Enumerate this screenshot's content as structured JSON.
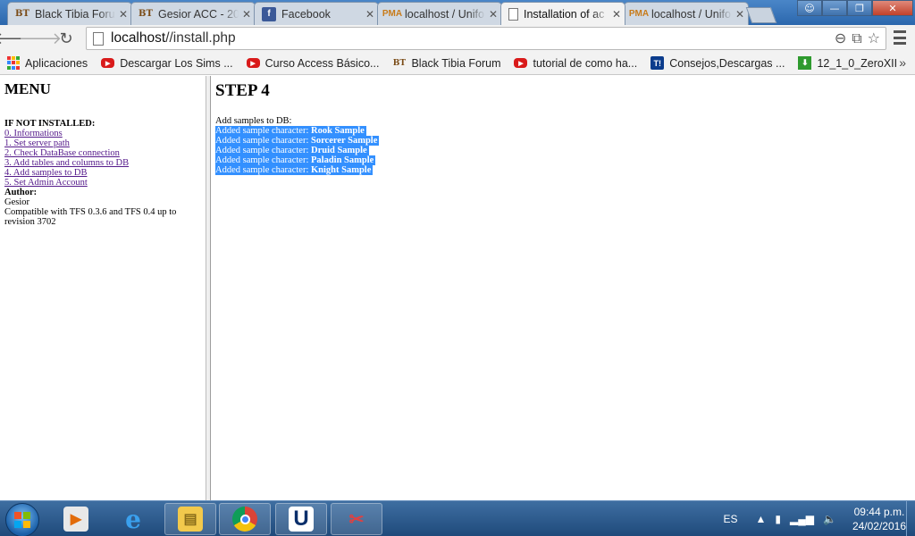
{
  "browser": {
    "tabs": [
      {
        "title": "Black Tibia Foru",
        "favicon": "bt-logo-icon",
        "active": false
      },
      {
        "title": "Gesior ACC - 20",
        "favicon": "bt-logo-icon",
        "active": false
      },
      {
        "title": "Facebook",
        "favicon": "facebook-icon",
        "active": false
      },
      {
        "title": "localhost / Unifo",
        "favicon": "phpmyadmin-icon",
        "active": false
      },
      {
        "title": "Installation of ac",
        "favicon": "page-icon",
        "active": true
      },
      {
        "title": "localhost / Unifo",
        "favicon": "phpmyadmin-icon",
        "active": false
      }
    ],
    "tab_close_glyph": "✕",
    "window_buttons": {
      "minimize": "—",
      "maximize": "❐",
      "close": "✕"
    },
    "url_host": "localhost",
    "url_path": "//install.php",
    "bookmarks": [
      {
        "label": "Aplicaciones",
        "icon": "apps-grid-icon"
      },
      {
        "label": "Descargar Los Sims ...",
        "icon": "youtube-icon"
      },
      {
        "label": "Curso Access Básico...",
        "icon": "youtube-icon"
      },
      {
        "label": "Black Tibia Forum",
        "icon": "bt-logo-icon"
      },
      {
        "label": "tutorial de como ha...",
        "icon": "youtube-icon"
      },
      {
        "label": "Consejos,Descargas ...",
        "icon": "taringa-icon"
      },
      {
        "label": "12_1_0_ZeroXII",
        "icon": "download-icon"
      }
    ],
    "bookmarks_more": "»"
  },
  "left_menu": {
    "title": "MENU",
    "section_heading": "IF NOT INSTALLED:",
    "links": [
      "0. Informations",
      "1. Set server path",
      "2. Check DataBase connection",
      "3. Add tables and columns to DB",
      "4. Add samples to DB",
      "5. Set Admin Account"
    ],
    "author_label": "Author:",
    "author_name": "Gesior",
    "compat_text": "Compatible with TFS 0.3.6 and TFS 0.4 up to revision 3702"
  },
  "main": {
    "title": "STEP 4",
    "intro": "Add samples to DB:",
    "line_prefix": "Added sample character:",
    "samples": [
      "Rook Sample",
      "Sorcerer Sample",
      "Druid Sample",
      "Paladin Sample",
      "Knight Sample"
    ],
    "selection_color": "#3390ff"
  },
  "taskbar": {
    "apps": [
      {
        "name": "media-player-icon",
        "glyph": "▶"
      },
      {
        "name": "internet-explorer-icon",
        "glyph": "e"
      },
      {
        "name": "file-explorer-icon",
        "glyph": "▤"
      },
      {
        "name": "chrome-icon",
        "glyph": ""
      },
      {
        "name": "uniserver-icon",
        "glyph": "U"
      },
      {
        "name": "tool-icon",
        "glyph": "✂"
      }
    ],
    "language": "ES",
    "time": "09:44 p.m.",
    "date": "24/02/2016"
  }
}
